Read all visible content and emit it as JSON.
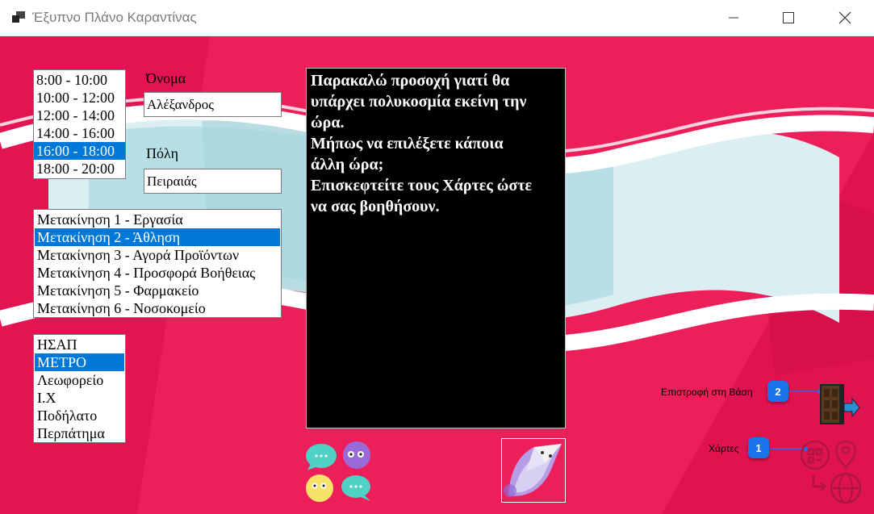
{
  "window": {
    "title": "Έξυπνο Πλάνο Καραντίνας"
  },
  "time_slots": {
    "items": [
      "8:00 - 10:00",
      "10:00 - 12:00",
      "12:00 - 14:00",
      "14:00 - 16:00",
      "16:00 - 18:00",
      "18:00 - 20:00"
    ],
    "selected": "16:00 - 18:00"
  },
  "name_field": {
    "label": "Όνομα",
    "value": "Αλέξανδρος"
  },
  "city_field": {
    "label": "Πόλη",
    "value": "Πειραιάς"
  },
  "movement_reasons": {
    "items": [
      "Μετακίνηση 1 - Εργασία",
      "Μετακίνηση 2 - Άθληση",
      "Μετακίνηση 3 - Αγορά Προϊόντων",
      "Μετακίνηση 4 - Προσφορά Βοήθειας",
      "Μετακίνηση 5 - Φαρμακείο",
      "Μετακίνηση 6 - Νοσοκομείο"
    ],
    "selected": "Μετακίνηση 2 - Άθληση"
  },
  "transport": {
    "items": [
      "ΗΣΑΠ",
      "ΜΕΤΡΟ",
      "Λεωφορείο",
      "Ι.Χ",
      "Ποδήλατο",
      "Περπάτημα"
    ],
    "selected": "ΜΕΤΡΟ"
  },
  "message": {
    "lines": [
      "Παρακαλώ προσοχή γιατί θα",
      "υπάρχει πολυκοσμία εκείνη την",
      "ώρα.",
      "Μήπως να επιλέξετε κάποια",
      "άλλη ώρα;",
      "Επισκεφτείτε τους Χάρτες ώστε",
      "να σας βοηθήσουν."
    ]
  },
  "actions": {
    "back": {
      "label": "Επιστροφή στη Βάση",
      "badge": "2",
      "icon": "door-exit-icon"
    },
    "maps": {
      "label": "Χάρτες",
      "badge": "1",
      "icon": "map-location-icon"
    }
  },
  "colors": {
    "background": "#ec1f5b",
    "selection": "#0078d7",
    "badge": "#1a73e8",
    "message_bg": "#000000"
  }
}
